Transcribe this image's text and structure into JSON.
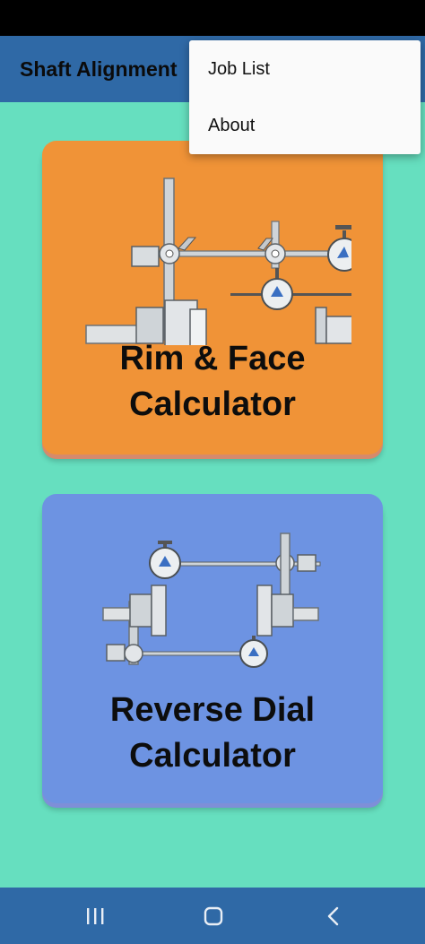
{
  "app": {
    "title": "Shaft Alignment"
  },
  "menu": {
    "items": [
      {
        "label": "Job List"
      },
      {
        "label": "About"
      }
    ]
  },
  "cards": [
    {
      "line1": "Rim & Face",
      "line2": "Calculator",
      "bg": "#f09337"
    },
    {
      "line1": "Reverse Dial",
      "line2": "Calculator",
      "bg": "#6d93e2"
    }
  ],
  "colors": {
    "app_bar": "#2f69a6",
    "content_bg": "#66dfbf",
    "nav_bar": "#2f69a6"
  },
  "nav": {
    "buttons": [
      "recent-apps-icon",
      "home-icon",
      "back-icon"
    ]
  }
}
